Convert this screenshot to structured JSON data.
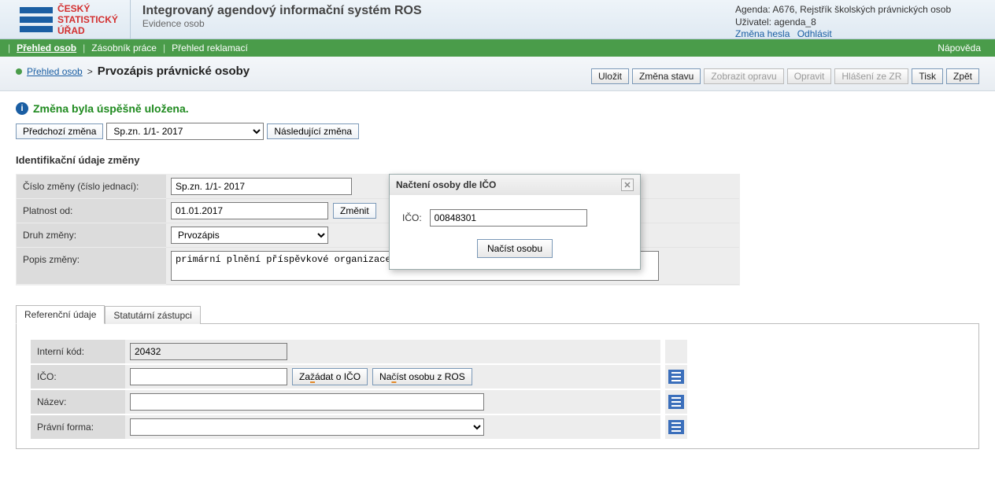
{
  "header": {
    "logo_l1": "ČESKÝ",
    "logo_l2": "STATISTICKÝ",
    "logo_l3": "ÚŘAD",
    "title": "Integrovaný agendový informační systém ROS",
    "subtitle": "Evidence osob",
    "agenda_label": "Agenda:",
    "agenda_value": "A676, Rejstřík školských právnických osob",
    "user_label": "Uživatel:",
    "user_value": "agenda_8",
    "link_change_pw": "Změna hesla",
    "link_logout": "Odhlásit"
  },
  "nav": {
    "item1": "Přehled osob",
    "item2": "Zásobník práce",
    "item3": "Přehled reklamací",
    "help": "Nápověda"
  },
  "breadcrumb": {
    "link": "Přehled osob",
    "sep": ">",
    "current": "Prvozápis právnické osoby"
  },
  "actions": {
    "save": "Uložit",
    "change_state": "Změna stavu",
    "show_correction": "Zobrazit opravu",
    "correct": "Opravit",
    "zr_report": "Hlášení ze ZR",
    "print": "Tisk",
    "back": "Zpět"
  },
  "message": "Změna byla úspěšně uložena.",
  "change_nav": {
    "prev": "Předchozí změna",
    "select_value": "Sp.zn. 1/1- 2017",
    "next": "Následující změna"
  },
  "ident": {
    "title": "Identifikační údaje změny",
    "cislo_label": "Číslo změny (číslo jednací):",
    "cislo_val": "Sp.zn. 1/1- 2017",
    "platnost_label": "Platnost od:",
    "platnost_val": "01.01.2017",
    "platnost_btn": "Změnit",
    "druh_label": "Druh změny:",
    "druh_val": "Prvozápis",
    "popis_label": "Popis změny:",
    "popis_val": "primární plnění příspěvkové organizace"
  },
  "tabs": {
    "t1": "Referenční údaje",
    "t2": "Statutární zástupci"
  },
  "ref": {
    "interni_label": "Interní kód:",
    "interni_val": "20432",
    "ico_label": "IČO:",
    "ico_val": "",
    "ico_btn1_pre": "Za",
    "ico_btn1_u": "ž",
    "ico_btn1_post": "ádat o IČO",
    "ico_btn2_pre": "Na",
    "ico_btn2_u": "č",
    "ico_btn2_post": "íst osobu z ROS",
    "nazev_label": "Název:",
    "nazev_val": "",
    "pforma_label": "Právní forma:",
    "pforma_val": ""
  },
  "dialog": {
    "title": "Načtení osoby dle IČO",
    "ico_label": "IČO:",
    "ico_val": "00848301",
    "load_btn": "Načíst osobu"
  }
}
